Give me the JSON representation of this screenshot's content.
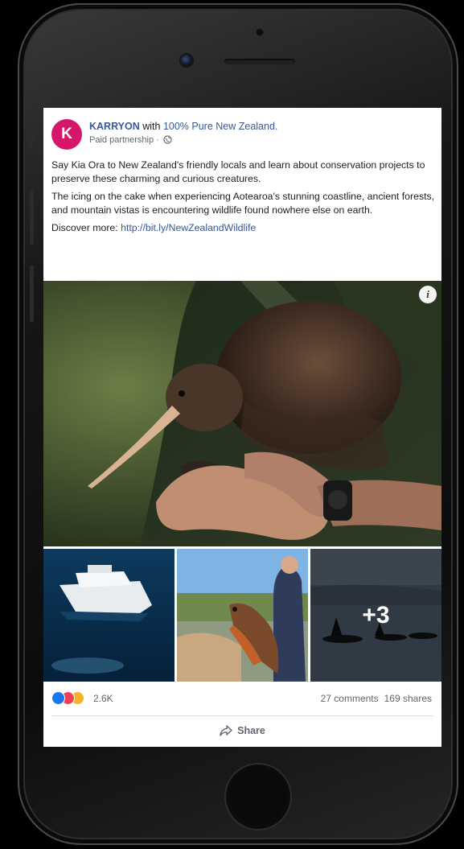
{
  "post": {
    "page_name": "KARRYON",
    "with_text": "with",
    "partner_name": "100% Pure New Zealand.",
    "avatar_letter": "K",
    "sponsored": "Paid partnership · ",
    "paragraphs": [
      "Say Kia Ora to New Zealand's friendly locals and learn about conservation projects to preserve these charming and curious creatures.",
      "The icing on the cake when experiencing Aotearoa's stunning coastline, ancient forests, and mountain vistas is encountering wildlife found nowhere else on earth."
    ],
    "discover_label": "Discover more: ",
    "discover_link": "http://bit.ly/NewZealandWildlife"
  },
  "media": {
    "info_icon": "i",
    "more_count": "+3"
  },
  "footer": {
    "reaction_count": "2.6K",
    "comments": "27 comments",
    "shares": "169 shares",
    "share_label": "Share"
  },
  "colors": {
    "brand_avatar": "#d5176a",
    "link": "#385898",
    "like": "#1877f2",
    "love": "#f33e58",
    "wow": "#f7b125"
  }
}
